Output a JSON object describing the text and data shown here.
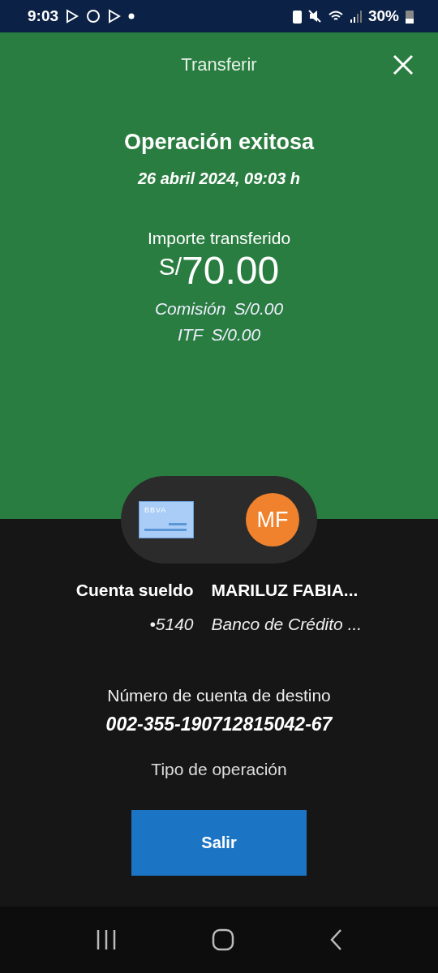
{
  "status_bar": {
    "time": "9:03",
    "battery": "30%"
  },
  "header": {
    "title": "Transferir"
  },
  "result": {
    "title": "Operación exitosa",
    "date": "26 abril 2024, 09:03 h",
    "amount_label": "Importe transferido",
    "currency": "S/",
    "amount": "70.00",
    "fees": [
      {
        "label": "Comisión",
        "value": "S/0.00"
      },
      {
        "label": "ITF",
        "value": "S/0.00"
      }
    ]
  },
  "origin": {
    "card_label": "BBVA",
    "name": "Cuenta sueldo",
    "number": "•5140"
  },
  "destination": {
    "initials": "MF",
    "name": "MARILUZ FABIA...",
    "bank": "Banco de Crédito ..."
  },
  "details": [
    {
      "label": "Número de cuenta de destino",
      "value": "002-355-190712815042-67"
    }
  ],
  "partial_label": "Tipo de operación",
  "button": "Salir"
}
